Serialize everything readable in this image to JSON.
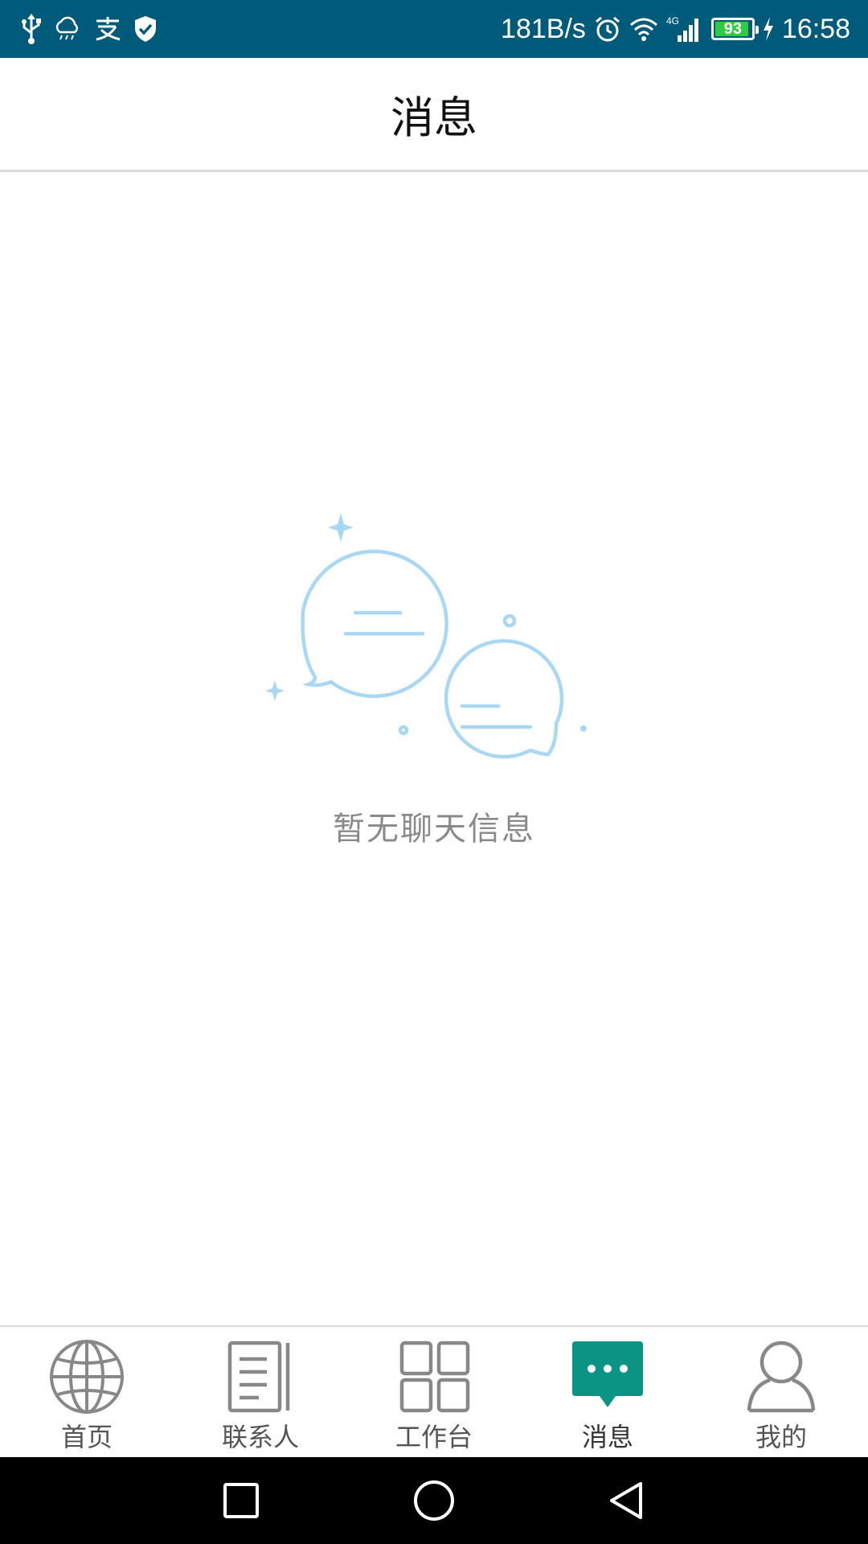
{
  "status_bar": {
    "network_speed": "181B/s",
    "signal_type": "4G",
    "battery_level": "93",
    "battery_fraction": 0.93,
    "time": "16:58",
    "left_icons": [
      "usb-icon",
      "weather-rain-icon",
      "alipay-icon",
      "shield-check-icon"
    ],
    "right_icons": [
      "alarm-icon",
      "wifi-icon",
      "cell-signal-icon",
      "battery-icon",
      "charging-icon"
    ]
  },
  "header": {
    "title": "消息"
  },
  "empty_state": {
    "text": "暂无聊天信息",
    "illustration": "chat-bubbles-icon",
    "accent_color": "#a9d8f5"
  },
  "tabs": [
    {
      "label": "首页",
      "icon": "globe-icon",
      "active": false
    },
    {
      "label": "联系人",
      "icon": "contacts-book-icon",
      "active": false
    },
    {
      "label": "工作台",
      "icon": "grid-icon",
      "active": false
    },
    {
      "label": "消息",
      "icon": "message-icon",
      "active": true
    },
    {
      "label": "我的",
      "icon": "person-icon",
      "active": false
    }
  ],
  "colors": {
    "status_bar_bg": "#005a7a",
    "active_tab": "#0a9484",
    "inactive_tab": "#888888"
  },
  "nav_bar": {
    "buttons": [
      "recent-apps-icon",
      "home-icon",
      "back-icon"
    ]
  }
}
